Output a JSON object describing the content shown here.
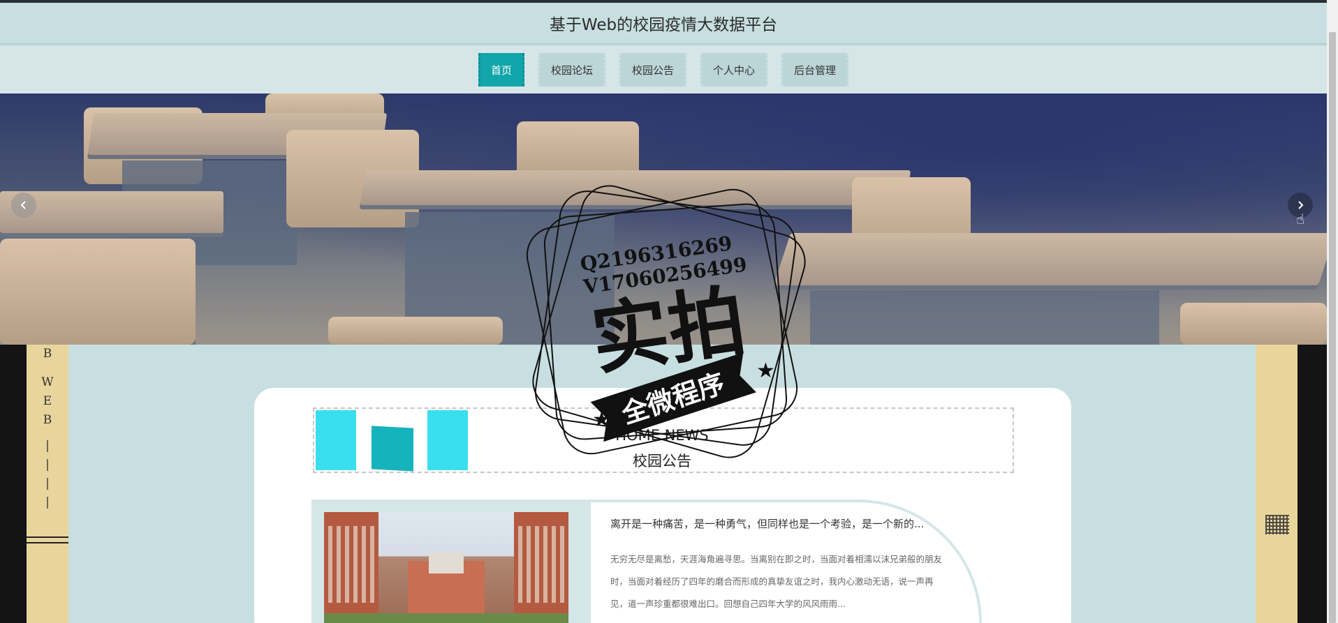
{
  "header": {
    "title": "基于Web的校园疫情大数据平台"
  },
  "nav": {
    "items": [
      {
        "label": "首页",
        "active": true
      },
      {
        "label": "校园论坛",
        "active": false
      },
      {
        "label": "校园公告",
        "active": false
      },
      {
        "label": "个人中心",
        "active": false
      },
      {
        "label": "后台管理",
        "active": false
      }
    ]
  },
  "banner": {
    "prev_icon": "chevron-left-icon",
    "next_icon": "chevron-right-icon"
  },
  "sidebar_left": {
    "chars": [
      "B",
      "",
      "W",
      "E",
      "B",
      "",
      "|",
      "|",
      "|",
      "|"
    ]
  },
  "news_section": {
    "title": "HOME NEWS",
    "subtitle": "校园公告",
    "item": {
      "title": "离开是一种痛苦，是一种勇气，但同样也是一个考验，是一个新的...",
      "body": "无穷无尽是离愁，天涯海角遍寻思。当离别在即之时，当面对着相濡以沫兄弟般的朋友时，当面对着经历了四年的磨合而形成的真挚友谊之时，我内心激动无语，说一声再见，道一声珍重都很难出口。回想自己四年大学的风风雨雨..."
    }
  },
  "watermark": {
    "line1": "Q2196316269",
    "line2": "V17060256499",
    "main": "实拍",
    "ribbon": "全微程序"
  },
  "colors": {
    "accent": "#12a5aa",
    "background": "#c8dfe1",
    "side_panel": "#e8d59c"
  }
}
